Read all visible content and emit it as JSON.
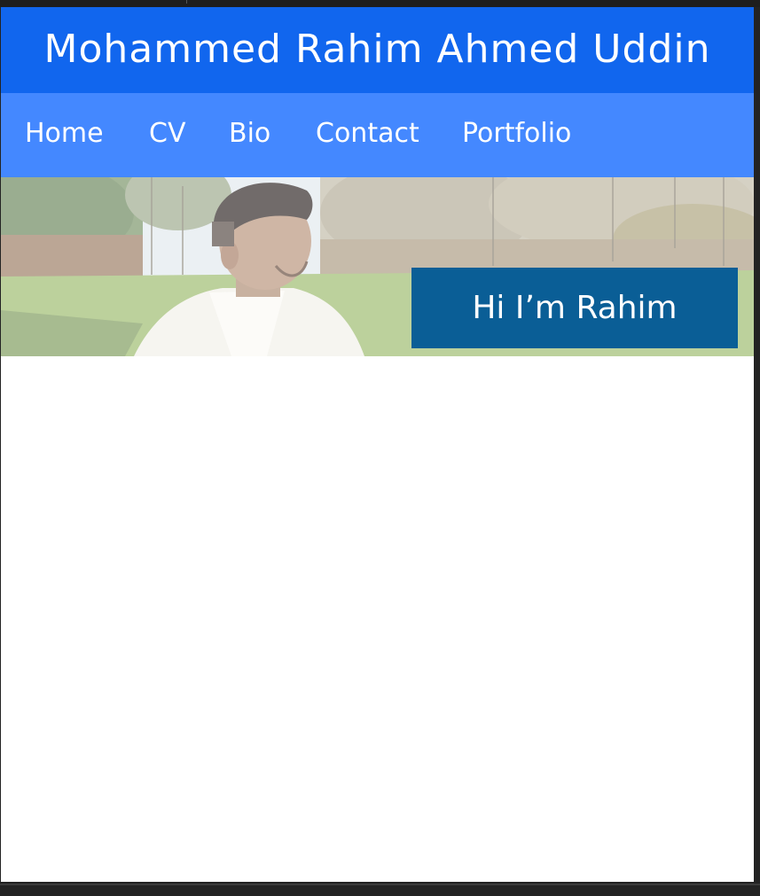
{
  "site": {
    "title": "Mohammed Rahim Ahmed Uddin"
  },
  "nav": {
    "items": [
      {
        "label": "Home"
      },
      {
        "label": "CV"
      },
      {
        "label": "Bio"
      },
      {
        "label": "Contact"
      },
      {
        "label": "Portfolio"
      }
    ]
  },
  "hero": {
    "greeting": "Hi I’m Rahim",
    "image_alt": "person-in-park-photo"
  },
  "colors": {
    "header": "#1166ee",
    "nav": "#4488ff",
    "greeting_box": "#0a5e96",
    "page_background": "#ffffff",
    "window_frame": "#232323"
  }
}
